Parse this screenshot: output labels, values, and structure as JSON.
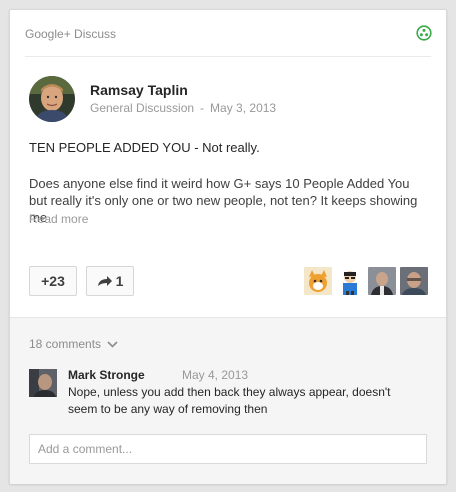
{
  "header": {
    "community_name": "Google+ Discuss",
    "community_icon": "community-circle-icon",
    "accent_color": "#3bab4a"
  },
  "post": {
    "author": "Ramsay Taplin",
    "category": "General Discussion",
    "separator": "-",
    "date": "May 3, 2013",
    "title": "TEN PEOPLE ADDED YOU - Not really.",
    "body": "Does anyone else find it weird how G+ says 10 People Added You but really it's only one or two new people, not ten? It keeps showing me",
    "read_more": "Read more"
  },
  "actions": {
    "plus_label": "+23",
    "share_count": "1",
    "share_icon": "share-arrow-icon"
  },
  "plusers": [
    {
      "name": "pluser-1"
    },
    {
      "name": "pluser-2"
    },
    {
      "name": "pluser-3"
    },
    {
      "name": "pluser-4"
    }
  ],
  "comments": {
    "count_label": "18 comments",
    "items": [
      {
        "author": "Mark Stronge",
        "date": "May 4, 2013",
        "text": "Nope, unless you add then back they always appear, doesn't seem to be any way of removing then"
      }
    ],
    "input_placeholder": "Add a comment..."
  }
}
